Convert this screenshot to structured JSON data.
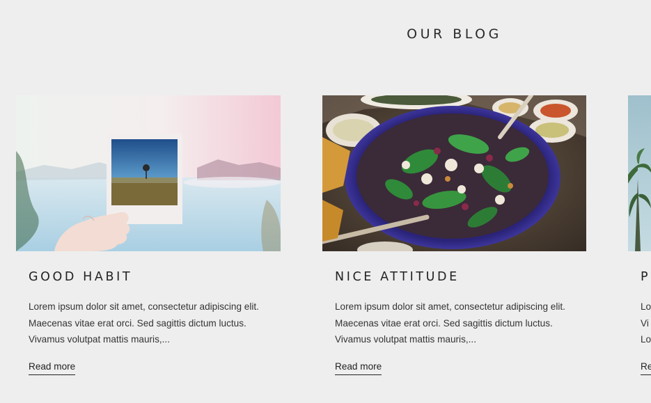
{
  "section": {
    "title": "OUR BLOG"
  },
  "posts": [
    {
      "title": "GOOD HABIT",
      "excerpt_lines": [
        "Lorem ipsum dolor sit amet, consectetur adipiscing elit.",
        "Maecenas vitae erat orci. Sed sagittis dictum luctus.",
        "Vivamus volutpat mattis mauris,..."
      ],
      "read_more": "Read more"
    },
    {
      "title": "NICE ATTITUDE",
      "excerpt_lines": [
        "Lorem ipsum dolor sit amet, consectetur adipiscing elit.",
        "Maecenas vitae erat orci. Sed sagittis dictum luctus.",
        "Vivamus volutpat mattis mauris,..."
      ],
      "read_more": "Read more"
    },
    {
      "title": "P",
      "excerpt_lines": [
        "Lo",
        "Vi",
        "Lo"
      ],
      "read_more": "Re"
    }
  ]
}
